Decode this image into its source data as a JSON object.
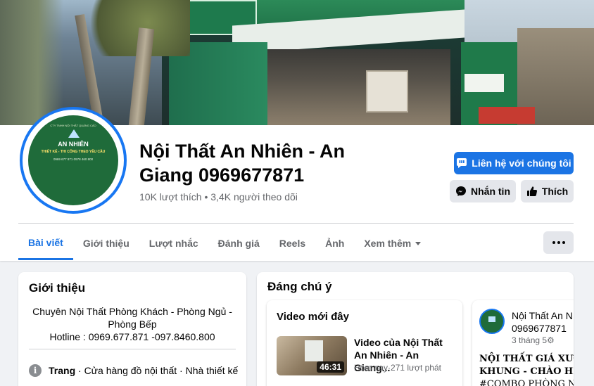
{
  "page": {
    "name": "Nội Thất An Nhiên - An Giang 0969677871",
    "stats": "10K lượt thích • 3,4K người theo dõi"
  },
  "avatar": {
    "line1": "CTY TNHH NỘI THẤT QUẢNG CÁO",
    "brand": "AN NHIÊN",
    "tagline": "THIẾT KẾ - THI CÔNG THEO YÊU CẦU",
    "phones": "0969 677 871   0978 460 800"
  },
  "actions": {
    "contact": "Liên hệ với chúng tôi",
    "message": "Nhắn tin",
    "like": "Thích"
  },
  "tabs": [
    {
      "label": "Bài viết",
      "active": true
    },
    {
      "label": "Giới thiệu"
    },
    {
      "label": "Lượt nhắc"
    },
    {
      "label": "Đánh giá"
    },
    {
      "label": "Reels"
    },
    {
      "label": "Ảnh"
    },
    {
      "label": "Xem thêm"
    }
  ],
  "intro": {
    "title": "Giới thiệu",
    "bio": "Chuyên Nội Thất Phòng Khách - Phòng Ngủ - Phòng Bếp",
    "hotline": "Hotline : 0969.677.871 -097.8460.800",
    "category_label": "Trang",
    "category_value": " · Cửa hàng đồ nội thất · Nhà thiết kế"
  },
  "featured": {
    "title": "Đáng chú ý",
    "recent_videos": {
      "label": "Video mới đây",
      "video_title": "Video của Nội Thất An Nhiên - An Giang...",
      "duration": "46:31",
      "meta": "Hôm nay·271 lượt phát"
    },
    "post": {
      "author_line1": "Nội Thất An N",
      "author_line2": "0969677871",
      "time": "3 tháng 5",
      "line1": "NỘI THẤT GIÁ XƯƠN",
      "line2": "KHUNG - CHÀO HÈ S",
      "line3": "#COMBO PHÒNG NG"
    }
  },
  "colors": {
    "accent": "#1b74e4",
    "background": "#f0f2f5",
    "secondary_button": "#e4e6eb"
  }
}
